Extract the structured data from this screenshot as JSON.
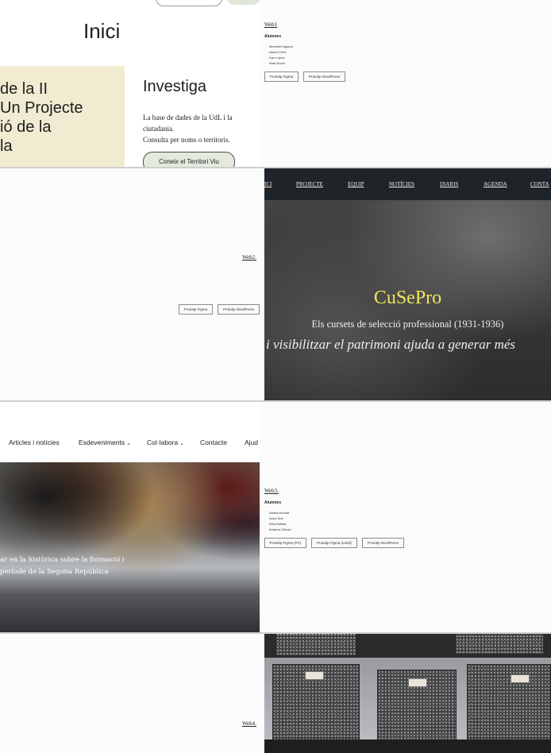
{
  "row1": {
    "left": {
      "title": "Inici",
      "feature_text": "de la II\nUn Projecte\nió de la\nla",
      "heading": "Investiga",
      "desc_lines": [
        "La base de dades de la UdL i la",
        "ciutadania.",
        "Consulta per noms o territoris."
      ],
      "cta": "Coneix el Territori Viu"
    },
    "right": {
      "link": "Web1",
      "label": "Alumnes",
      "students": [
        "Meritxell Higueró",
        "Noemi Terré",
        "Ivan López",
        "Iñaki Noval"
      ],
      "buttons": [
        "Prototip Figma",
        "Prototip WordPress"
      ]
    }
  },
  "row2": {
    "left": {
      "link": "Web2.",
      "buttons": [
        "Prototip Figma",
        "Prototip WordPress"
      ]
    },
    "right": {
      "nav": [
        "ICI",
        "PROJECTE",
        "EQUIP",
        "NOTÍCIES",
        "DIARIS",
        "AGENDA",
        "CONTA"
      ],
      "title": "CuSePro",
      "subtitle": "Els cursets de selecció professional (1931-1936)",
      "tagline": "i visibilitzar el patrimoni ajuda a generar més"
    }
  },
  "row3": {
    "left": {
      "nav": [
        "Articles i notícies",
        "Esdeveniments",
        "Col·labora",
        "Contacte",
        "Ajud"
      ],
      "hero_text": "ar en la històrica sobre la formació i\nperíode de la Segona República"
    },
    "right": {
      "link": "Web3.",
      "label": "Alumnes",
      "students": [
        "Aitana Arruñat",
        "Anna Ubé",
        "Elba Batista",
        "Ariadna Ortinez"
      ],
      "buttons": [
        "Prototip Figma (PC)",
        "Prototip Figma (mòvil)",
        "Prototip WordPress"
      ]
    }
  },
  "row4": {
    "left": {
      "link": "Web4."
    }
  }
}
